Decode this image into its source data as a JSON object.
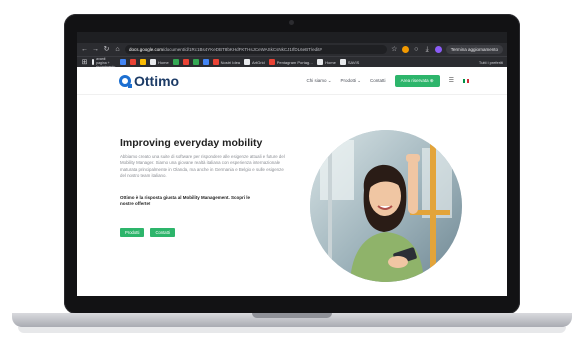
{
  "browser": {
    "url_host": "docs.google.com",
    "url_path": "/document/d/1Rc1Bs4YKeDBT8bKHdFKTHsJCeWASkCsNkCJ1IfDL6eBT/edit#",
    "update_label": "Termina aggiornamento",
    "bookmarks": [
      {
        "label": "Grafica avanti pagina + risorgimento",
        "color": "#e8eaed",
        "small": true
      },
      {
        "label": "",
        "color": "#4285f4"
      },
      {
        "label": "",
        "color": "#ea4335"
      },
      {
        "label": "",
        "color": "#fbbc05"
      },
      {
        "label": "Home",
        "color": "#e8eaed"
      },
      {
        "label": "",
        "color": "#34a853"
      },
      {
        "label": "",
        "color": "#ea4335"
      },
      {
        "label": "",
        "color": "#34a853"
      },
      {
        "label": "",
        "color": "#4285f4"
      },
      {
        "label": "Nostri Idea",
        "color": "#ea4335"
      },
      {
        "label": "ArtGrid",
        "color": "#e8eaed"
      },
      {
        "label": "Pentagram Portag…",
        "color": "#ea4335"
      },
      {
        "label": "Home",
        "color": "#e8eaed"
      },
      {
        "label": "SAVIS",
        "color": "#e8eaed"
      }
    ],
    "all_bookmarks": "Tutti i preferiti"
  },
  "site": {
    "logo": "Ottimo",
    "menu": [
      "Chi siamo ⌄",
      "Prodotti ⌄",
      "Contatti"
    ],
    "cta": "Area riservata ⊕",
    "hero": {
      "title": "Improving everyday mobility",
      "body": "Abbiamo creato una suite di software per rispondere alle esigenze attuali e future del Mobility Manager. Siamo una giovane realtà italiana con esperienza internazionale maturata principalmente in Olanda, ma anche in Germania e Belgio e sulle esigenze del nostro team italiano.",
      "strong": "Ottimo è la risposta giusta al Mobility Management. Scopri le nostre offerte!",
      "buttons": [
        "Prodotti",
        "Contatti"
      ]
    }
  },
  "colors": {
    "brand": "#1c6fd1",
    "logo_text": "#1c3b66",
    "accent_green": "#2db56b"
  }
}
